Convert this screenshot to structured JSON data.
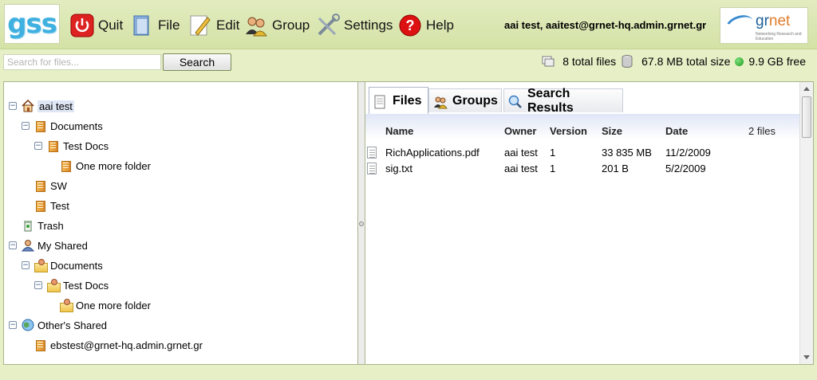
{
  "app": {
    "logo_text": "gss",
    "menu": [
      {
        "key": "quit",
        "label": "Quit",
        "icon": "power-icon"
      },
      {
        "key": "file",
        "label": "File",
        "icon": "file-icon"
      },
      {
        "key": "edit",
        "label": "Edit",
        "icon": "pencil-icon"
      },
      {
        "key": "group",
        "label": "Group",
        "icon": "group-icon"
      },
      {
        "key": "settings",
        "label": "Settings",
        "icon": "tools-icon"
      },
      {
        "key": "help",
        "label": "Help",
        "icon": "help-icon"
      }
    ],
    "user_label": "aai test, aaitest@grnet-hq.admin.grnet.gr",
    "partner_logo": {
      "text_gr": "gr",
      "text_net": "net",
      "tagline": "Networking Research and Education"
    }
  },
  "search": {
    "placeholder": "Search for files...",
    "button_label": "Search"
  },
  "stats": {
    "total_files": "8 total files",
    "total_size": "67.8 MB total size",
    "free": "9.9 GB free"
  },
  "tree": {
    "items": [
      {
        "label": "aai test",
        "icon": "home-icon"
      },
      {
        "label": "Documents",
        "icon": "folder-icon"
      },
      {
        "label": "Test Docs",
        "icon": "folder-icon"
      },
      {
        "label": "One more folder",
        "icon": "folder-icon"
      },
      {
        "label": "SW",
        "icon": "folder-icon"
      },
      {
        "label": "Test",
        "icon": "folder-icon"
      },
      {
        "label": "Trash",
        "icon": "trash-icon"
      },
      {
        "label": "My Shared",
        "icon": "user-icon"
      },
      {
        "label": "Documents",
        "icon": "shared-folder-icon"
      },
      {
        "label": "Test Docs",
        "icon": "shared-folder-icon"
      },
      {
        "label": "One more folder",
        "icon": "shared-folder-icon"
      },
      {
        "label": "Other's Shared",
        "icon": "globe-icon"
      },
      {
        "label": "ebstest@grnet-hq.admin.grnet.gr",
        "icon": "folder-icon"
      }
    ]
  },
  "tabs": [
    {
      "label": "Files",
      "icon": "files-icon",
      "active": true
    },
    {
      "label": "Groups",
      "icon": "groups-icon",
      "active": false
    },
    {
      "label": "Search Results",
      "icon": "magnifier-icon",
      "active": false
    }
  ],
  "files_table": {
    "headers": {
      "name": "Name",
      "owner": "Owner",
      "version": "Version",
      "size": "Size",
      "date": "Date",
      "count": "2 files"
    },
    "rows": [
      {
        "name": "RichApplications.pdf",
        "owner": "aai test",
        "version": "1",
        "size": "33 835 MB",
        "date": "11/2/2009"
      },
      {
        "name": "sig.txt",
        "owner": "aai test",
        "version": "1",
        "size": "201 B",
        "date": "5/2/2009"
      }
    ]
  }
}
